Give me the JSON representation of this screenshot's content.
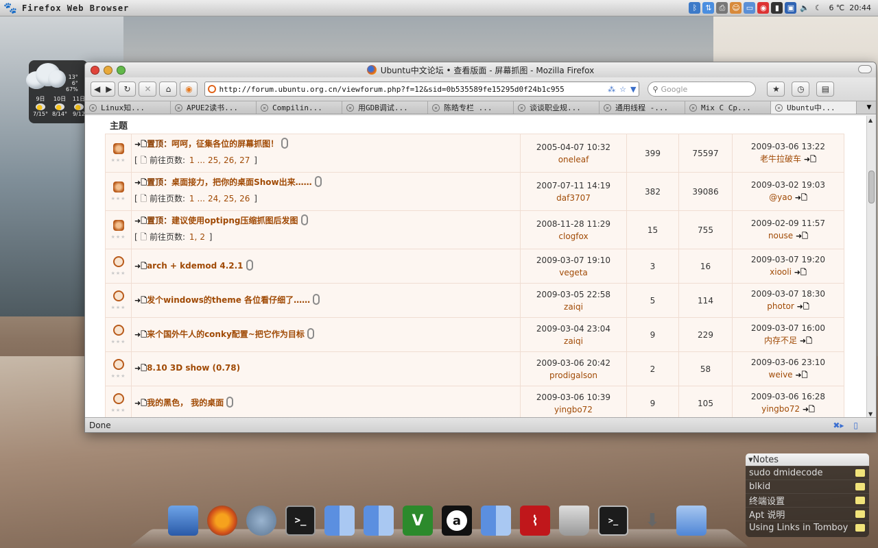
{
  "panel": {
    "app_title": "Firefox Web Browser",
    "weather": "6 ℃",
    "clock": "20:44"
  },
  "weather_widget": {
    "temps": [
      "13°",
      "6°",
      "67%"
    ],
    "days": [
      {
        "name": "9日",
        "range": "7/15°"
      },
      {
        "name": "10日",
        "range": "8/14°"
      },
      {
        "name": "11日",
        "range": "9/12"
      }
    ]
  },
  "window": {
    "title": "Ubuntu中文论坛 • 查看版面 - 屏幕抓图 - Mozilla Firefox",
    "url": "http://forum.ubuntu.org.cn/viewforum.php?f=12&sid=0b535589fe15295d0f24b1c955",
    "search_placeholder": "Google",
    "status": "Done"
  },
  "tabs": [
    {
      "label": "Linux知..."
    },
    {
      "label": "APUE2读书..."
    },
    {
      "label": "Compilin..."
    },
    {
      "label": "用GDB调试..."
    },
    {
      "label": "陈皓专栏  ..."
    },
    {
      "label": "谈谈职业规..."
    },
    {
      "label": "通用线程 -..."
    },
    {
      "label": "Mix C Cp..."
    },
    {
      "label": "Ubuntu中..."
    }
  ],
  "forum": {
    "header": "主题",
    "sticky_prefix": "置顶：",
    "pages_label": "前往页数:",
    "topics": [
      {
        "title": "呵呵，征集各位的屏幕抓图！",
        "sticky": true,
        "clip": true,
        "pages": [
          "1",
          "...",
          "25,",
          "26,",
          "27"
        ],
        "date": "2005-04-07 10:32",
        "author": "oneleaf",
        "replies": "399",
        "views": "75597",
        "last_date": "2009-03-06 13:22",
        "last_user": "老牛拉破车"
      },
      {
        "title": "桌面接力，把你的桌面Show出来……",
        "sticky": true,
        "clip": true,
        "pages": [
          "1",
          "...",
          "24,",
          "25,",
          "26"
        ],
        "date": "2007-07-11 14:19",
        "author": "daf3707",
        "replies": "382",
        "views": "39086",
        "last_date": "2009-03-02 19:03",
        "last_user": "@yao"
      },
      {
        "title": "建议使用optipng压缩抓图后发图",
        "sticky": true,
        "clip": true,
        "pages": [
          "1,",
          "2"
        ],
        "date": "2008-11-28 11:29",
        "author": "clogfox",
        "replies": "15",
        "views": "755",
        "last_date": "2009-02-09 11:57",
        "last_user": "nouse"
      },
      {
        "title": "arch + kdemod 4.2.1",
        "sticky": false,
        "clip": true,
        "date": "2009-03-07 19:10",
        "author": "vegeta",
        "replies": "3",
        "views": "16",
        "last_date": "2009-03-07 19:20",
        "last_user": "xiooli"
      },
      {
        "title": "发个windows的theme 各位看仔细了……",
        "sticky": false,
        "clip": true,
        "date": "2009-03-05 22:58",
        "author": "zaiqi",
        "replies": "5",
        "views": "114",
        "last_date": "2009-03-07 18:30",
        "last_user": "photor"
      },
      {
        "title": "来个国外牛人的conky配置~把它作为目标",
        "sticky": false,
        "clip": true,
        "date": "2009-03-04 23:04",
        "author": "zaiqi",
        "replies": "9",
        "views": "229",
        "last_date": "2009-03-07 16:00",
        "last_user": "内存不足"
      },
      {
        "title": "8.10 3D show (0.78)",
        "sticky": false,
        "clip": false,
        "date": "2009-03-06 20:42",
        "author": "prodigalson",
        "replies": "2",
        "views": "58",
        "last_date": "2009-03-06 23:10",
        "last_user": "weive"
      },
      {
        "title": "我的黑色， 我的桌面",
        "sticky": false,
        "clip": true,
        "date": "2009-03-06 10:39",
        "author": "yingbo72",
        "replies": "9",
        "views": "105",
        "last_date": "2009-03-06 16:28",
        "last_user": "yingbo72"
      }
    ]
  },
  "notes": {
    "header": "Notes",
    "items": [
      "sudo dmidecode",
      "blkid",
      "终端设置",
      "Apt 说明",
      "Using Links in Tomboy"
    ]
  },
  "dock": {
    "items": [
      "desktop-icon",
      "firefox-icon",
      "network-icon",
      "terminal-icon",
      "finder-icon",
      "finder-icon",
      "vim-icon",
      "amarok-icon",
      "finder-icon",
      "pdf-reader-icon",
      "trash-icon",
      "terminal-icon",
      "download-icon",
      "folder-icon"
    ]
  }
}
